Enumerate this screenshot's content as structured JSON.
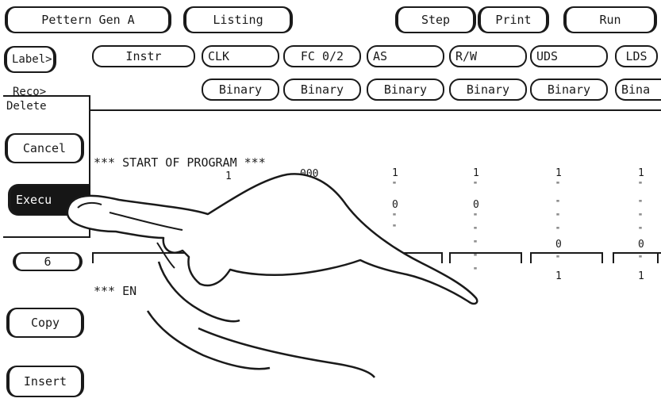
{
  "top_bar": {
    "mode": "Pettern Gen A",
    "view": "Listing",
    "step": "Step",
    "print": "Print",
    "run": "Run"
  },
  "label_row": {
    "label_button": "Label>",
    "instr": "Instr",
    "columns": [
      "CLK",
      "FC 0/2",
      "AS",
      "R/W",
      "UDS",
      "LDS"
    ]
  },
  "base_row": {
    "reco_button": "Reco>",
    "bases": [
      "Binary",
      "Binary",
      "Binary",
      "Binary",
      "Binary",
      "Bina"
    ]
  },
  "delete_popup": {
    "title": "Delete",
    "cancel": "Cancel",
    "execute": "Execu"
  },
  "listing": {
    "start_marker": "*** START OF PROGRAM ***",
    "end_marker": "*** EN",
    "clk_value": "1",
    "fc_value": "000",
    "as_values": [
      "1",
      "0"
    ],
    "rw_values": [
      "1",
      "0"
    ],
    "uds_values": [
      "1",
      "0",
      "1"
    ],
    "lds_values": [
      "1",
      "0",
      "1"
    ]
  },
  "side_panel": {
    "line_number": "6",
    "copy": "Copy",
    "insert": "Insert"
  }
}
